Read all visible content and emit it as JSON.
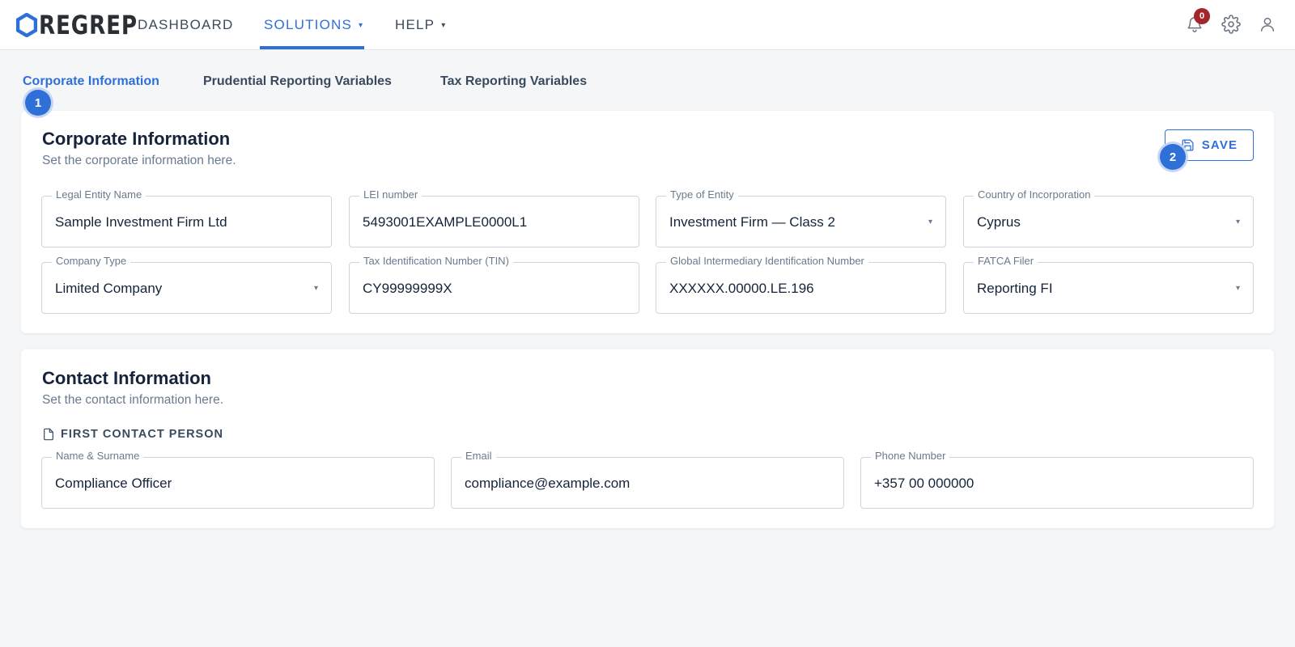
{
  "app": {
    "logo_text": "REGREP",
    "brand_color": "#2f6fd8"
  },
  "nav": {
    "items": [
      {
        "label": "DASHBOARD",
        "has_dropdown": false,
        "active": false
      },
      {
        "label": "SOLUTIONS",
        "has_dropdown": true,
        "active": true
      },
      {
        "label": "HELP",
        "has_dropdown": true,
        "active": false
      }
    ],
    "caret": "▾",
    "notification_count": "0",
    "icons": [
      "bell-icon",
      "gear-icon",
      "user-icon"
    ]
  },
  "tabs": [
    {
      "label": "Corporate Information",
      "active": true
    },
    {
      "label": "Prudential Reporting Variables",
      "active": false
    },
    {
      "label": "Tax Reporting Variables",
      "active": false
    }
  ],
  "step_badges": [
    "1",
    "2"
  ],
  "corporate": {
    "title": "Corporate Information",
    "subtitle": "Set the corporate information here.",
    "save_label": "SAVE",
    "fields": [
      {
        "label": "Legal Entity Name",
        "value": "Sample Investment Firm Ltd",
        "type": "text"
      },
      {
        "label": "LEI number",
        "value": "5493001EXAMPLE0000L1",
        "type": "text"
      },
      {
        "label": "Type of Entity",
        "value": "Investment Firm — Class 2",
        "type": "select"
      },
      {
        "label": "Country of Incorporation",
        "value": "Cyprus",
        "type": "select"
      },
      {
        "label": "Company Type",
        "value": "Limited Company",
        "type": "select"
      },
      {
        "label": "Tax Identification Number (TIN)",
        "value": "CY99999999X",
        "type": "text"
      },
      {
        "label": "Global Intermediary Identification Number",
        "value": "XXXXXX.00000.LE.196",
        "type": "text"
      },
      {
        "label": "FATCA Filer",
        "value": "Reporting FI",
        "type": "select"
      }
    ]
  },
  "contact": {
    "title": "Contact Information",
    "subtitle": "Set the contact information here.",
    "section_label": "FIRST CONTACT PERSON",
    "fields": [
      {
        "label": "Name & Surname",
        "value": "Compliance Officer"
      },
      {
        "label": "Email",
        "value": "compliance@example.com"
      },
      {
        "label": "Phone Number",
        "value": "+357 00 000000"
      }
    ]
  }
}
